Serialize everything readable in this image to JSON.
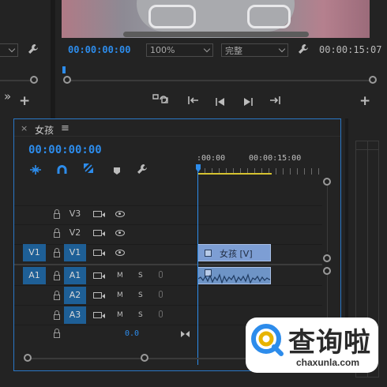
{
  "program_monitor": {
    "timecode_current": "00:00:00:00",
    "zoom": "100%",
    "quality": "完整",
    "timecode_duration": "00:00:15:07"
  },
  "timeline": {
    "tab_name": "女孩",
    "menu_glyph": "≡",
    "close_glyph": "×",
    "timecode": "00:00:00:00",
    "ruler": [
      ":00:00",
      "00:00:15:00"
    ],
    "video_tracks": [
      {
        "name": "V3"
      },
      {
        "name": "V2"
      },
      {
        "name": "V1",
        "source": "V1"
      }
    ],
    "audio_tracks": [
      {
        "name": "A1",
        "source": "A1",
        "m": "M",
        "s": "S"
      },
      {
        "name": "A2",
        "m": "M",
        "s": "S"
      },
      {
        "name": "A3",
        "m": "M",
        "s": "S"
      }
    ],
    "master_volume": "0.0",
    "video_clip_label": "女孩 [V]",
    "playhead_color": "#2d8ceb",
    "clip_color": "#7d9ed4"
  },
  "watermark": {
    "brand": "查询啦",
    "url": "chaxunla.com",
    "accent_color": "#2d8ceb"
  }
}
